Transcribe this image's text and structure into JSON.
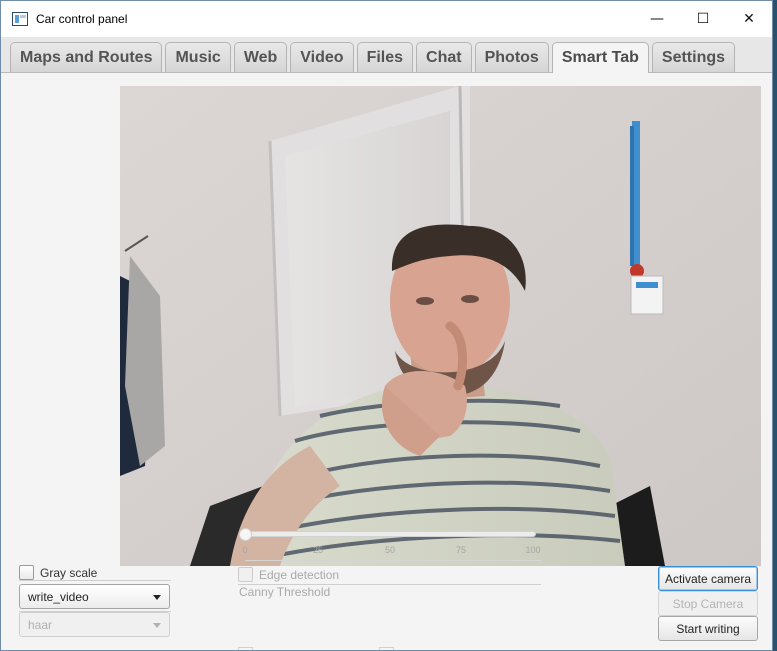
{
  "window": {
    "title": "Car control panel",
    "controls": {
      "minimize": "—",
      "maximize": "☐",
      "close": "✕"
    }
  },
  "tabs": [
    {
      "label": "Maps and Routes",
      "active": false
    },
    {
      "label": "Music",
      "active": false
    },
    {
      "label": "Web",
      "active": false
    },
    {
      "label": "Video",
      "active": false
    },
    {
      "label": "Files",
      "active": false
    },
    {
      "label": "Chat",
      "active": false
    },
    {
      "label": "Photos",
      "active": false
    },
    {
      "label": "Smart Tab",
      "active": true
    },
    {
      "label": "Settings",
      "active": false
    }
  ],
  "camera": {
    "feed": "live-camera-feed"
  },
  "left_controls": {
    "gray_scale_label": "Gray scale",
    "gray_scale_checked": false,
    "mode_select_value": "write_video",
    "classifier_select_value": "haar"
  },
  "middle_controls": {
    "edge_detection_label": "Edge detection",
    "edge_detection_checked": false,
    "canny_label": "Canny Threshold",
    "canny_value": 0,
    "canny_ticks": [
      "0",
      "25",
      "50",
      "75",
      "100"
    ]
  },
  "right_controls": {
    "activate_label": "Activate camera",
    "stop_label": "Stop Camera",
    "start_writing_label": "Start writing"
  },
  "colors": {
    "accent_focus": "#3a8fd6",
    "tab_text": "#545454",
    "disabled_text": "#a9a9a9"
  }
}
